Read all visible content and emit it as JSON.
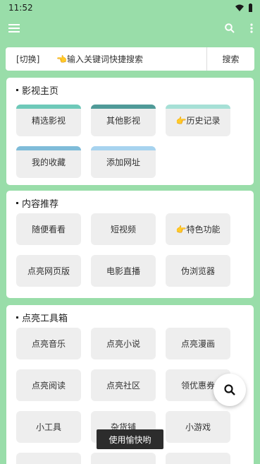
{
  "status": {
    "time": "11:52"
  },
  "icons": {
    "menu": "menu-icon",
    "search": "search-icon",
    "more": "more-vert-icon",
    "wifi": "wifi-icon",
    "battery": "battery-icon"
  },
  "search": {
    "switch_label": "[切换]",
    "placeholder": "👈输入关键词快捷搜索",
    "button_label": "搜索"
  },
  "sections": [
    {
      "title": "影视主页",
      "tiles": [
        {
          "label": "精选影视",
          "accent": "#6ec9b9"
        },
        {
          "label": "其他影视",
          "accent": "#4f9a98"
        },
        {
          "label": "👉历史记录",
          "accent": "#a6e0d6"
        },
        {
          "label": "我的收藏",
          "accent": "#7fbcd9"
        },
        {
          "label": "添加网址",
          "accent": "#a7d3ef"
        }
      ]
    },
    {
      "title": "内容推荐",
      "tiles": [
        {
          "label": "随便看看"
        },
        {
          "label": "短视频"
        },
        {
          "label": "👉特色功能"
        },
        {
          "label": "点亮网页版"
        },
        {
          "label": "电影直播"
        },
        {
          "label": "伪浏览器"
        }
      ]
    },
    {
      "title": "点亮工具箱",
      "tiles": [
        {
          "label": "点亮音乐"
        },
        {
          "label": "点亮小说"
        },
        {
          "label": "点亮漫画"
        },
        {
          "label": "点亮阅读"
        },
        {
          "label": "点亮社区"
        },
        {
          "label": "领优惠券"
        },
        {
          "label": "小工具"
        },
        {
          "label": "杂货铺"
        },
        {
          "label": "小游戏"
        },
        {
          "label": ""
        },
        {
          "label": ""
        },
        {
          "label": ""
        }
      ]
    }
  ],
  "toast": "使用愉快哟",
  "colors": {
    "background": "#99dda9",
    "card": "#ffffff",
    "tile": "#eeeeee"
  }
}
